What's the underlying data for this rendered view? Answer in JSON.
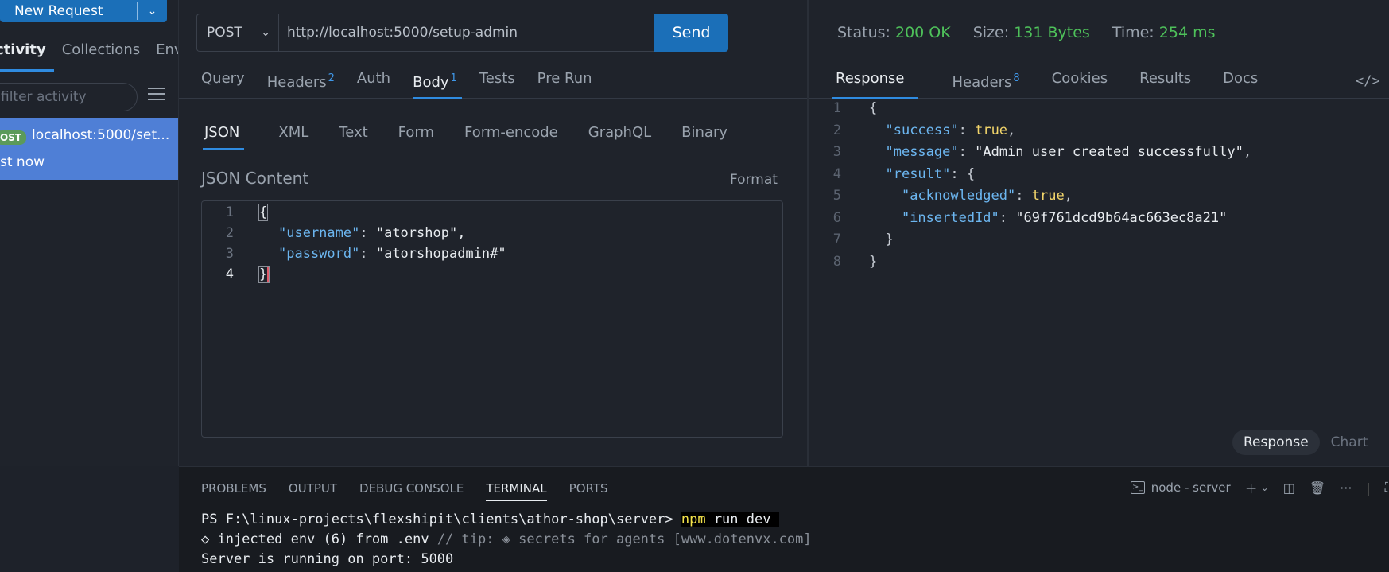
{
  "sidebar": {
    "new_request_label": "New Request",
    "tabs": [
      {
        "label": "ctivity"
      },
      {
        "label": "Collections"
      },
      {
        "label": "Env"
      }
    ],
    "filter_placeholder": "filter activity",
    "activity": {
      "method_badge": "OST",
      "url": "localhost:5000/set...",
      "time": "st now"
    }
  },
  "request": {
    "method": "POST",
    "url": "http://localhost:5000/setup-admin",
    "send_label": "Send",
    "tabs": [
      {
        "label": "Query",
        "badge": ""
      },
      {
        "label": "Headers",
        "badge": "2"
      },
      {
        "label": "Auth",
        "badge": ""
      },
      {
        "label": "Body",
        "badge": "1"
      },
      {
        "label": "Tests",
        "badge": ""
      },
      {
        "label": "Pre Run",
        "badge": ""
      }
    ],
    "body_tabs": [
      "JSON",
      "XML",
      "Text",
      "Form",
      "Form-encode",
      "GraphQL",
      "Binary"
    ],
    "json_label": "JSON Content",
    "format_label": "Format",
    "body_lines": [
      {
        "n": "1",
        "text": "{"
      },
      {
        "n": "2",
        "key": "\"username\"",
        "value": "\"atorshop\","
      },
      {
        "n": "3",
        "key": "\"password\"",
        "value": "\"atorshopadmin#\""
      },
      {
        "n": "4",
        "text": "}"
      }
    ]
  },
  "response": {
    "status_label": "Status:",
    "status_value": "200 OK",
    "size_label": "Size:",
    "size_value": "131 Bytes",
    "time_label": "Time:",
    "time_value": "254 ms",
    "tabs": [
      {
        "label": "Response",
        "badge": ""
      },
      {
        "label": "Headers",
        "badge": "8"
      },
      {
        "label": "Cookies",
        "badge": ""
      },
      {
        "label": "Results",
        "badge": ""
      },
      {
        "label": "Docs",
        "badge": ""
      }
    ],
    "code_icon": "</>",
    "lines": [
      {
        "n": "1",
        "text": "{"
      },
      {
        "n": "2",
        "indent": "  ",
        "key": "\"success\"",
        "value": "true",
        "tail": ","
      },
      {
        "n": "3",
        "indent": "  ",
        "key": "\"message\"",
        "value": "\"Admin user created successfully\"",
        "tail": ","
      },
      {
        "n": "4",
        "indent": "  ",
        "key": "\"result\"",
        "value": "{",
        "tail": ""
      },
      {
        "n": "5",
        "indent": "    ",
        "key": "\"acknowledged\"",
        "value": "true",
        "tail": ","
      },
      {
        "n": "6",
        "indent": "    ",
        "key": "\"insertedId\"",
        "value": "\"69f761dcd9b64ac663ec8a21\"",
        "tail": ""
      },
      {
        "n": "7",
        "text": "  }"
      },
      {
        "n": "8",
        "text": "}"
      }
    ],
    "view_options": [
      "Response",
      "Chart"
    ]
  },
  "terminal": {
    "tabs": [
      "PROBLEMS",
      "OUTPUT",
      "DEBUG CONSOLE",
      "TERMINAL",
      "PORTS"
    ],
    "active_tab": "TERMINAL",
    "session_label": "node - server",
    "prompt": "PS F:\\linux-projects\\flexshipit\\clients\\athor-shop\\server> ",
    "command_bin": "npm",
    "command_args": " run dev ",
    "line2_main": "◇ injected env (6) from .env ",
    "line2_tip": "// tip: ◈ secrets for agents [www.dotenvx.com]",
    "line3": "Server is running on port: 5000"
  }
}
